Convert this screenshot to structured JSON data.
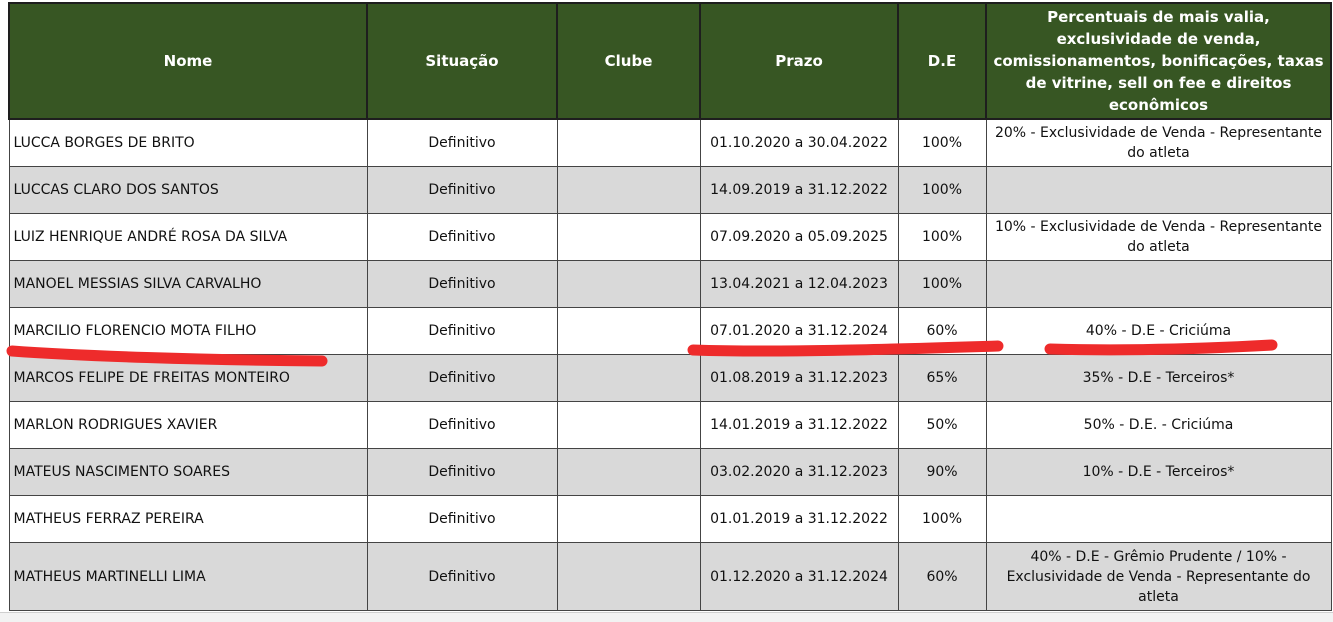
{
  "table": {
    "headers": [
      "Nome",
      "Situação",
      "Clube",
      "Prazo",
      "D.E",
      "Percentuais de mais valia, exclusividade de venda, comissionamentos, bonificações, taxas de vitrine, sell on fee e direitos econômicos"
    ],
    "rows": [
      {
        "nome": "LUCCA BORGES DE BRITO",
        "situacao": "Definitivo",
        "clube": "",
        "prazo": "01.10.2020 a 30.04.2022",
        "de": "100%",
        "percentuais": "20% - Exclusividade de Venda - Representante do atleta"
      },
      {
        "nome": "LUCCAS CLARO DOS SANTOS",
        "situacao": "Definitivo",
        "clube": "",
        "prazo": "14.09.2019 a 31.12.2022",
        "de": "100%",
        "percentuais": ""
      },
      {
        "nome": "LUIZ HENRIQUE ANDRÉ ROSA DA SILVA",
        "situacao": "Definitivo",
        "clube": "",
        "prazo": "07.09.2020 a 05.09.2025",
        "de": "100%",
        "percentuais": "10% - Exclusividade de Venda - Representante do atleta"
      },
      {
        "nome": "MANOEL MESSIAS SILVA CARVALHO",
        "situacao": "Definitivo",
        "clube": "",
        "prazo": "13.04.2021 a 12.04.2023",
        "de": "100%",
        "percentuais": ""
      },
      {
        "nome": "MARCILIO FLORENCIO MOTA FILHO",
        "situacao": "Definitivo",
        "clube": "",
        "prazo": "07.01.2020 a 31.12.2024",
        "de": "60%",
        "percentuais": "40% - D.E - Criciúma"
      },
      {
        "nome": "MARCOS FELIPE DE FREITAS MONTEIRO",
        "situacao": "Definitivo",
        "clube": "",
        "prazo": "01.08.2019 a 31.12.2023",
        "de": "65%",
        "percentuais": "35% - D.E - Terceiros*"
      },
      {
        "nome": "MARLON RODRIGUES XAVIER",
        "situacao": "Definitivo",
        "clube": "",
        "prazo": "14.01.2019 a 31.12.2022",
        "de": "50%",
        "percentuais": "50% - D.E. - Criciúma"
      },
      {
        "nome": "MATEUS NASCIMENTO SOARES",
        "situacao": "Definitivo",
        "clube": "",
        "prazo": "03.02.2020 a 31.12.2023",
        "de": "90%",
        "percentuais": "10% - D.E - Terceiros*"
      },
      {
        "nome": "MATHEUS FERRAZ PEREIRA",
        "situacao": "Definitivo",
        "clube": "",
        "prazo": "01.01.2019 a 31.12.2022",
        "de": "100%",
        "percentuais": ""
      },
      {
        "nome": "MATHEUS MARTINELLI LIMA",
        "situacao": "Definitivo",
        "clube": "",
        "prazo": "01.12.2020 a 31.12.2024",
        "de": "60%",
        "percentuais": "40% - D.E - Grêmio Prudente / 10% - Exclusividade de Venda - Representante do atleta"
      }
    ]
  },
  "colors": {
    "header_bg": "#375623",
    "header_text": "#ffffff",
    "row_alt": "#d9d9d9",
    "annotation": "#ee2b2b"
  }
}
